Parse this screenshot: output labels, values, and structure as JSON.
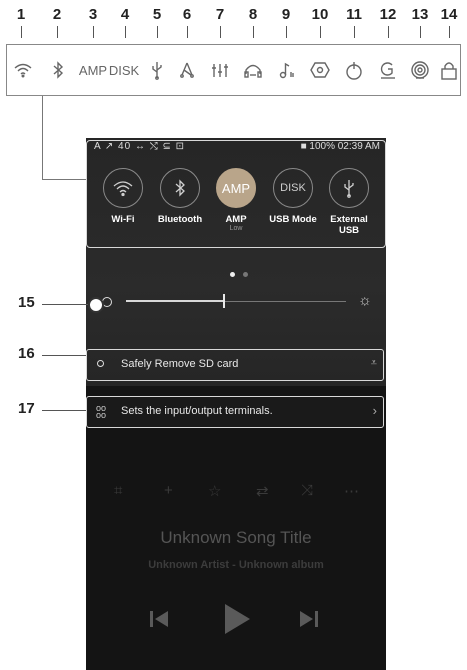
{
  "callouts_top": [
    "1",
    "2",
    "3",
    "4",
    "5",
    "6",
    "7",
    "8",
    "9",
    "10",
    "11",
    "12",
    "13",
    "14"
  ],
  "statusbar_icons": {
    "amp": "AMP",
    "disk": "DISK"
  },
  "device_status": {
    "left": "A ↗ 40  ↔  ⤭  ⊆  ⊡",
    "right": "■ 100% 02:39 AM"
  },
  "quick_tiles": [
    {
      "label": "Wi-Fi",
      "sub": "",
      "icon": "wifi-icon"
    },
    {
      "label": "Bluetooth",
      "sub": "",
      "icon": "bluetooth-icon"
    },
    {
      "label": "AMP",
      "sub": "Low",
      "icon": "amp-icon",
      "text": "AMP"
    },
    {
      "label": "USB Mode",
      "sub": "",
      "icon": "disk-icon",
      "text": "DISK"
    },
    {
      "label": "External USB",
      "sub": "",
      "icon": "usb-icon"
    }
  ],
  "callouts_side": [
    "15",
    "16",
    "17"
  ],
  "sd_card": "Safely Remove SD card",
  "io_terminals": "Sets the input/output terminals.",
  "song_title": "Unknown Song Title",
  "artist_album": "Unknown Artist - Unknown album",
  "brightness_level": 0.44
}
